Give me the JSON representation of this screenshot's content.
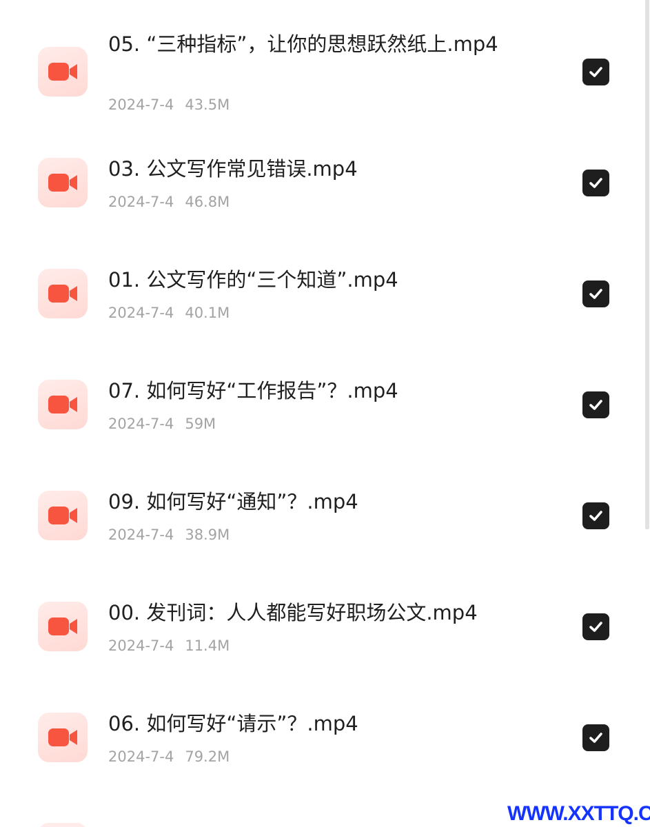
{
  "colors": {
    "icon_bg": "#ffecea",
    "icon_fg": "#f7553f",
    "checkbox_bg": "#1e1e1e",
    "name_text": "#1f1f1f",
    "meta_text": "#a3a3a3",
    "watermark": "#1433ff"
  },
  "files": [
    {
      "name": "05. “三种指标”，让你的思想跃然纸上.mp4",
      "date": "2024-7-4",
      "size": "43.5M",
      "icon": "video-camera-icon",
      "checked": true
    },
    {
      "name": "03. 公文写作常见错误.mp4",
      "date": "2024-7-4",
      "size": "46.8M",
      "icon": "video-camera-icon",
      "checked": true
    },
    {
      "name": "01. 公文写作的“三个知道”.mp4",
      "date": "2024-7-4",
      "size": "40.1M",
      "icon": "video-camera-icon",
      "checked": true
    },
    {
      "name": "07. 如何写好“工作报告”？.mp4",
      "date": "2024-7-4",
      "size": "59M",
      "icon": "video-camera-icon",
      "checked": true
    },
    {
      "name": "09. 如何写好“通知”？.mp4",
      "date": "2024-7-4",
      "size": "38.9M",
      "icon": "video-camera-icon",
      "checked": true
    },
    {
      "name": "00. 发刊词：人人都能写好职场公文.mp4",
      "date": "2024-7-4",
      "size": "11.4M",
      "icon": "video-camera-icon",
      "checked": true
    },
    {
      "name": "06. 如何写好“请示”？.mp4",
      "date": "2024-7-4",
      "size": "79.2M",
      "icon": "video-camera-icon",
      "checked": true
    }
  ],
  "watermark": "WWW.XXTTQ.COM"
}
